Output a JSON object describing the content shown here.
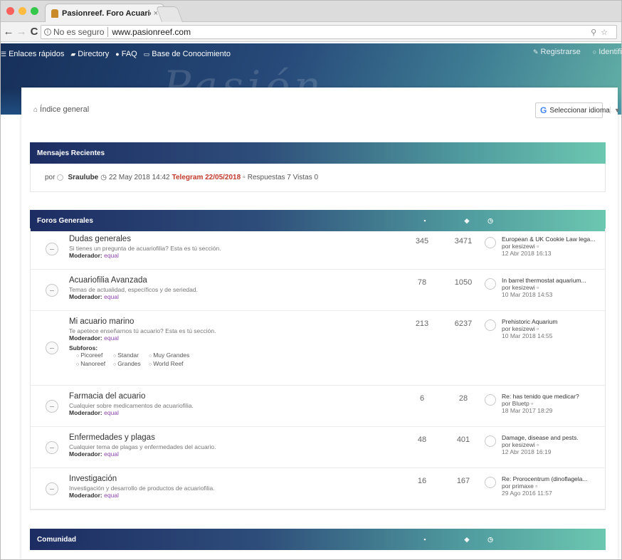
{
  "browser": {
    "tab_title": "Pasionreef. Foro Acuariofilia",
    "tab_close": "×",
    "security": "No es seguro",
    "url": "www.pasionreef.com",
    "icons": [
      "back-icon",
      "forward-icon",
      "reload-icon",
      "info-icon",
      "zoom-icon",
      "star-icon"
    ]
  },
  "site_nav": {
    "left": [
      {
        "icon": "menu-icon",
        "label": "Enlaces rápidos"
      },
      {
        "icon": "directory-icon",
        "label": "Directory"
      },
      {
        "icon": "question-icon",
        "label": "FAQ"
      },
      {
        "icon": "book-icon",
        "label": "Base de Conocimiento"
      }
    ],
    "right": [
      {
        "icon": "edit-icon",
        "label": "Registrarse"
      },
      {
        "icon": "power-icon",
        "label": "Identificarse"
      }
    ]
  },
  "header_word": "Pasión",
  "breadcrumb": "Índice general",
  "language_button": "Seleccionar idioma",
  "recent": {
    "title": "Mensajes Recientes",
    "prefix": "por",
    "user": "Sraulube",
    "date": "22 May 2018 14:42",
    "topic": "Telegram 22/05/2018",
    "stats": "Respuestas 7 Vistas 0"
  },
  "forums_general": {
    "title": "Foros Generales",
    "forums": [
      {
        "name": "Dudas generales",
        "desc": "Si tienes un pregunta de acuariofilia? Esta es tú sección.",
        "moderator_label": "Moderador:",
        "moderator": "equal",
        "topics": "345",
        "posts": "3471",
        "last_title": "European & UK Cookie Law lega...",
        "last_by": "por kesizewi",
        "last_date": "12 Abr 2018 16:13"
      },
      {
        "name": "Acuariofilia Avanzada",
        "desc": "Temas de actualidad, específicos y de seriedad.",
        "moderator_label": "Moderador:",
        "moderator": "equal",
        "topics": "78",
        "posts": "1050",
        "last_title": "In barrel thermostat aquarium...",
        "last_by": "por kesizewi",
        "last_date": "10 Mar 2018 14:53"
      },
      {
        "name": "Mi acuario marino",
        "desc": "Te apetece enseñarnos tú acuario? Esta es tú sección.",
        "moderator_label": "Moderador:",
        "moderator": "equal",
        "topics": "213",
        "posts": "6237",
        "last_title": "Prehistoric Aquarium",
        "last_by": "por kesizewi",
        "last_date": "10 Mar 2018 14:55",
        "subforos_label": "Subforos:",
        "subforos": [
          "Picoreef",
          "Standar",
          "Muy Grandes",
          "Nanoreef",
          "Grandes",
          "World Reef"
        ]
      },
      {
        "name": "Farmacia del acuario",
        "desc": "Cualquier sobre medicamentos de acuariofilia.",
        "moderator_label": "Moderador:",
        "moderator": "equal",
        "topics": "6",
        "posts": "28",
        "last_title": "Re: has tenido que medicar?",
        "last_by": "por Bluetp",
        "last_date": "18 Mar 2017 18:29"
      },
      {
        "name": "Enfermedades y plagas",
        "desc": "Cualquier tema de plagas y enfermedades del acuario.",
        "moderator_label": "Moderador:",
        "moderator": "equal",
        "topics": "48",
        "posts": "401",
        "last_title": "Damage, disease and pests.",
        "last_by": "por kesizewi",
        "last_date": "12 Abr 2018 16:19"
      },
      {
        "name": "Investigación",
        "desc": "Investigación y desarrollo de productos de acuariofilia.",
        "moderator_label": "Moderador:",
        "moderator": "equal",
        "topics": "16",
        "posts": "167",
        "last_title": "Re: Prorocentrum (dinoflagela...",
        "last_by": "por primaxe",
        "last_date": "29 Ago 2016 11:57"
      }
    ]
  },
  "comunidad": {
    "title": "Comunidad"
  },
  "colors": {
    "mod_link": "#8e44ad",
    "topic_link": "#c0392b",
    "bar_start": "#1d2d63",
    "bar_end": "#6cc7b0"
  }
}
